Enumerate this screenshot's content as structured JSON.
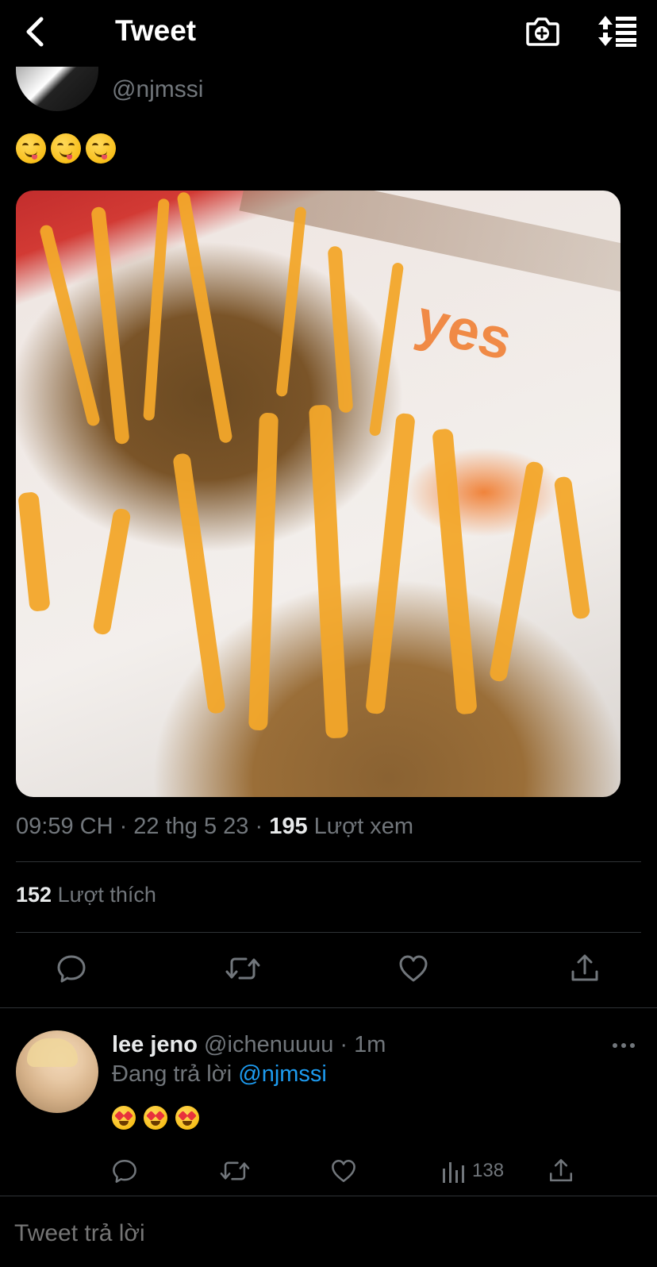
{
  "header": {
    "title": "Tweet"
  },
  "tweet": {
    "handle": "@njmssi",
    "time_date": "09:59 CH · 22 thg 5 23 · ",
    "views_count": "195",
    "views_label": " Lượt xem",
    "likes_count": "152",
    "likes_label": " Lượt thích",
    "photo_text": "yes"
  },
  "reply": {
    "name": "lee jeno",
    "handle_time": " @ichenuuuu · 1m",
    "replying_prefix": "Đang trả lời ",
    "replying_to": "@njmssi",
    "views": "138"
  },
  "compose": {
    "placeholder": "Tweet trả lời"
  },
  "colors": {
    "background": "#000000",
    "text": "#e7e9ea",
    "secondary": "#71767b",
    "link": "#1d9bf0",
    "divider": "#2f3336"
  }
}
